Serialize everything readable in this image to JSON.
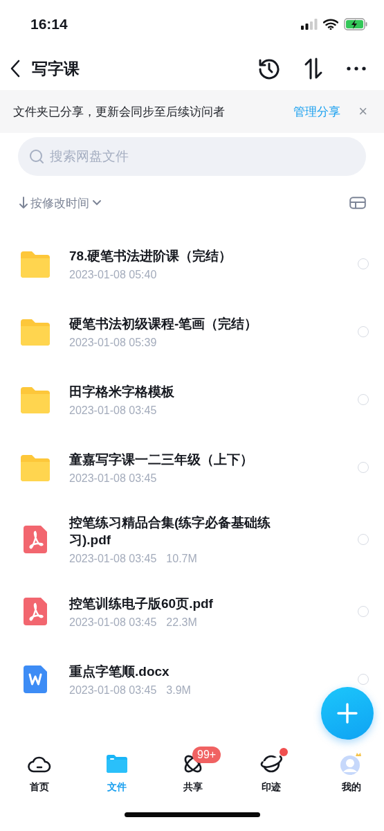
{
  "status_bar": {
    "time": "16:14"
  },
  "header": {
    "title": "写字课"
  },
  "banner": {
    "message": "文件夹已分享，更新会同步至后续访问者",
    "action": "管理分享",
    "close": "×"
  },
  "search": {
    "placeholder": "搜索网盘文件"
  },
  "sort": {
    "label": "按修改时间"
  },
  "files": [
    {
      "kind": "folder",
      "name": "78.硬笔书法进阶课（完结）",
      "date": "2023-01-08 05:40",
      "selected": false
    },
    {
      "kind": "folder",
      "name": "硬笔书法初级课程-笔画（完结）",
      "date": "2023-01-08 05:39",
      "selected": false
    },
    {
      "kind": "folder",
      "name": "田字格米字格模板",
      "date": "2023-01-08 03:45",
      "selected": false
    },
    {
      "kind": "folder",
      "name": "童嘉写字课一二三年级（上下）",
      "date": "2023-01-08 03:45",
      "selected": false
    },
    {
      "kind": "pdf",
      "name": "控笔练习精品合集(练字必备基础练习).pdf",
      "date": "2023-01-08 03:45",
      "size": "10.7M",
      "selected": false
    },
    {
      "kind": "pdf",
      "name": "控笔训练电子版60页.pdf",
      "date": "2023-01-08 03:45",
      "size": "22.3M",
      "selected": false
    },
    {
      "kind": "word",
      "name": "重点字笔顺.docx",
      "date": "2023-01-08 03:45",
      "size": "3.9M",
      "selected": false
    }
  ],
  "tabs": [
    {
      "kind": "home",
      "label": "首页",
      "selected": false
    },
    {
      "kind": "files",
      "label": "文件",
      "selected": true
    },
    {
      "kind": "share",
      "label": "共享",
      "selected": false,
      "badge": "99+"
    },
    {
      "kind": "planet",
      "label": "印迹",
      "selected": false,
      "dot": true
    },
    {
      "kind": "me",
      "label": "我的",
      "selected": false
    }
  ]
}
